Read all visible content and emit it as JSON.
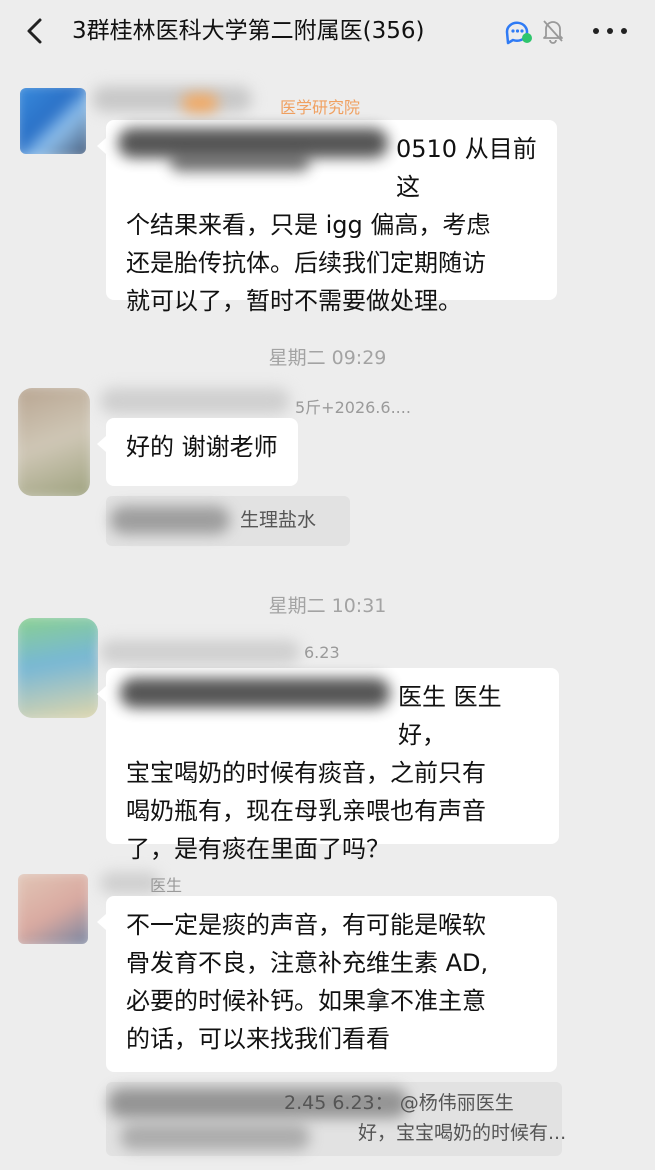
{
  "header": {
    "group_name": "3群桂林医科大学第二附属医",
    "member_count": "(356)",
    "icons": [
      "back-icon",
      "chat-group-icon",
      "muted-bell-icon",
      "more-icon"
    ]
  },
  "messages": [
    {
      "type": "text",
      "sender_visible": "医学研究院",
      "text_lines": [
        "0510 从目前这",
        "个结果来看，只是 igg 偏高，考虑",
        "还是胎传抗体。后续我们定期随访",
        "就可以了，暂时不需要做处理。"
      ]
    },
    {
      "type": "time",
      "text": "星期二 09:29"
    },
    {
      "type": "text",
      "sender_visible": "5斤+2026.6....",
      "text": "好的 谢谢老师",
      "quote": "生理盐水"
    },
    {
      "type": "time",
      "text": "星期二 10:31"
    },
    {
      "type": "text",
      "sender_visible": "6.23",
      "text_lines": [
        "医生 医生好，",
        "宝宝喝奶的时候有痰音，之前只有",
        "喝奶瓶有，现在母乳亲喂也有声音",
        "了，是有痰在里面了吗？"
      ]
    },
    {
      "type": "text",
      "sender_visible": "医生",
      "text_lines": [
        "不一定是痰的声音，有可能是喉软",
        "骨发育不良，注意补充维生素 AD,",
        "必要的时候补钙。如果拿不准主意",
        "的话，可以来找我们看看"
      ],
      "quote_lines": [
        "2.45 6.23： @杨伟丽医生",
        "好，宝宝喝奶的时候有..."
      ]
    }
  ],
  "colors": {
    "background": "#ededed",
    "bubble": "#ffffff",
    "quote_bg": "#e2e2e2",
    "time_text": "#a3a3a3",
    "sender_text": "#9a9a9a",
    "sender_org_text": "#f0a060"
  }
}
